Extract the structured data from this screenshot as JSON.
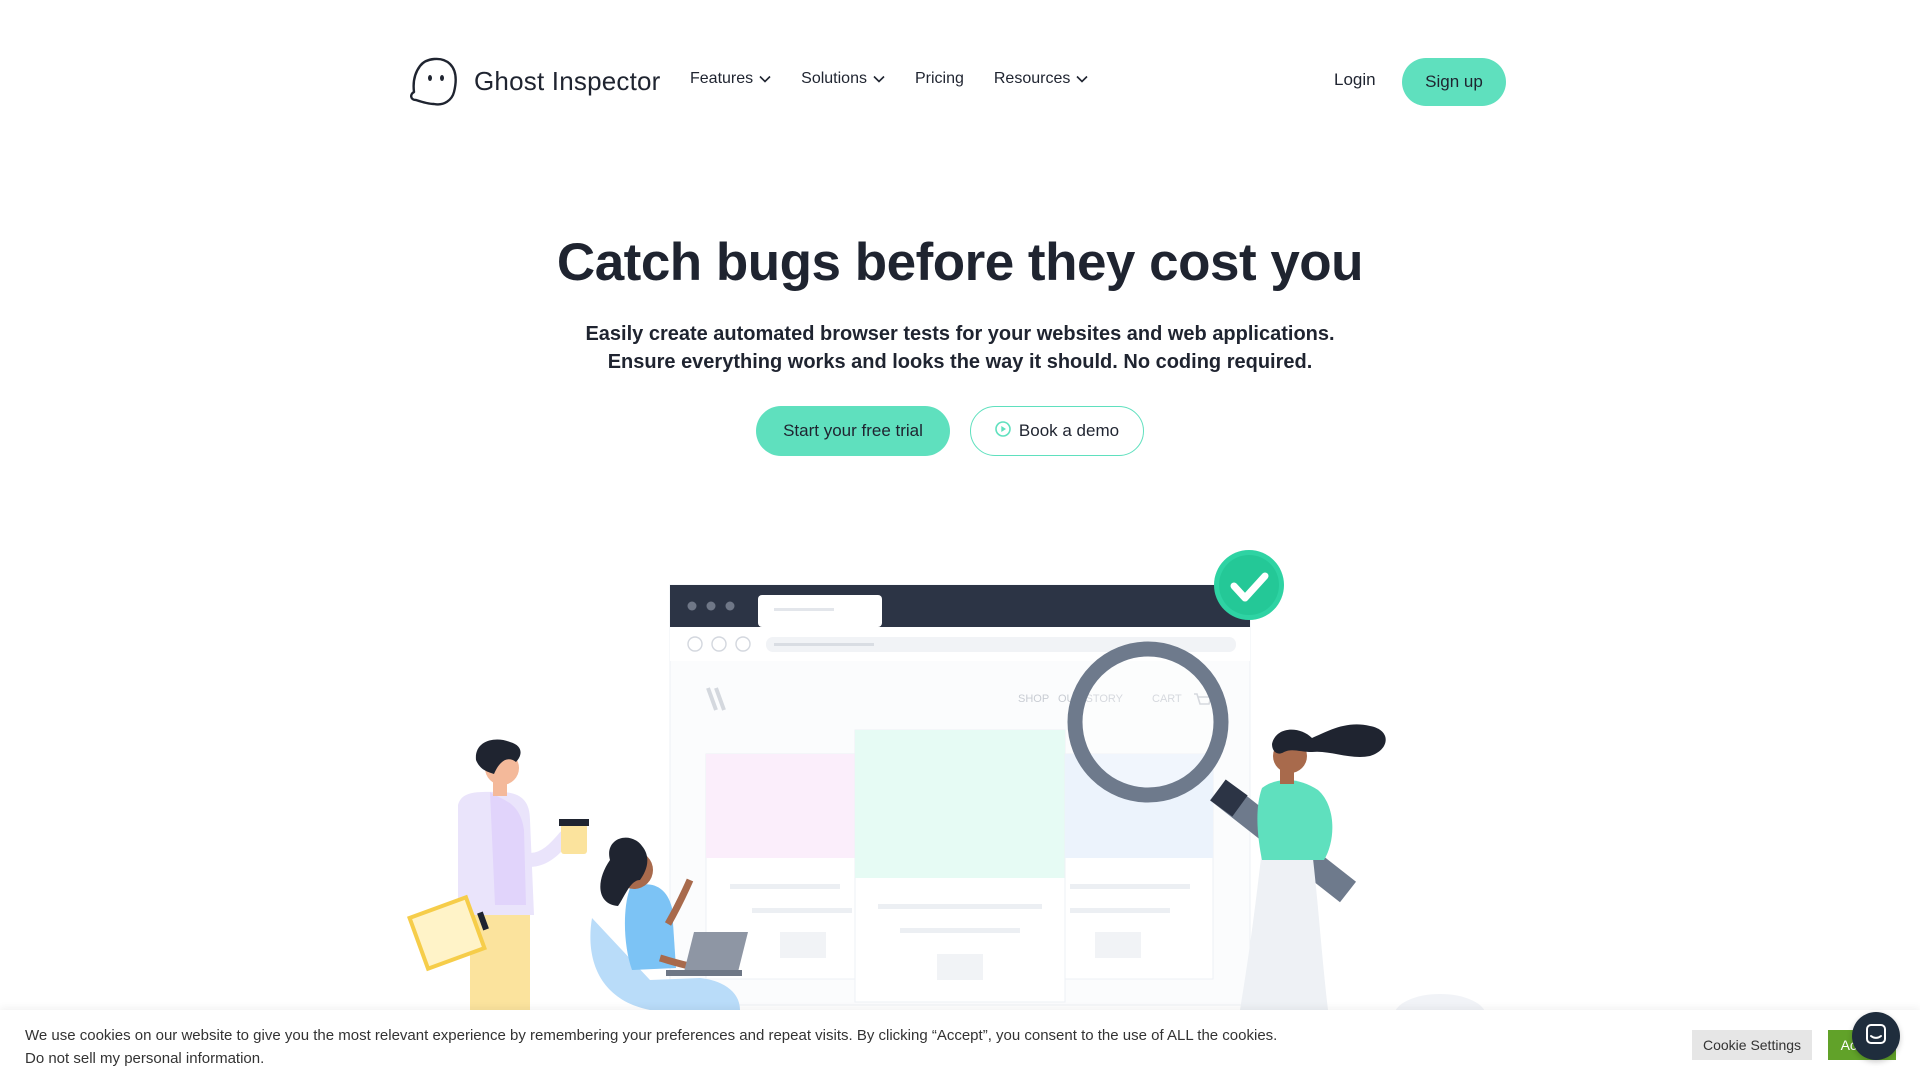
{
  "brand": {
    "name": "Ghost Inspector",
    "accent": "#5fe0be",
    "text_color": "#1f2430"
  },
  "nav": {
    "items": [
      {
        "label": "Features",
        "has_dropdown": true
      },
      {
        "label": "Solutions",
        "has_dropdown": true
      },
      {
        "label": "Pricing",
        "has_dropdown": false
      },
      {
        "label": "Resources",
        "has_dropdown": true
      }
    ],
    "login_label": "Login",
    "signup_label": "Sign up"
  },
  "hero": {
    "title": "Catch bugs before they cost you",
    "subtitle_line1": "Easily create automated browser tests for your websites and web applications.",
    "subtitle_line2": "Ensure everything works and looks the way it should. No coding required.",
    "primary_cta": "Start your free trial",
    "secondary_cta": "Book a demo"
  },
  "illustration": {
    "mock_nav": {
      "shop": "SHOP",
      "story": "OUR STORY",
      "cart": "CART"
    },
    "icons": [
      "ghost-logo-icon",
      "check-icon",
      "magnifier-icon",
      "cart-icon",
      "play-icon",
      "chat-icon"
    ]
  },
  "cookie": {
    "line1": "We use cookies on our website to give you the most relevant experience by remembering your preferences and repeat visits. By clicking “Accept”, you consent to the use of ALL the cookies.",
    "line2": "Do not sell my personal information.",
    "settings_label": "Cookie Settings",
    "accept_label": "Accept",
    "accept_color": "#61a229"
  }
}
